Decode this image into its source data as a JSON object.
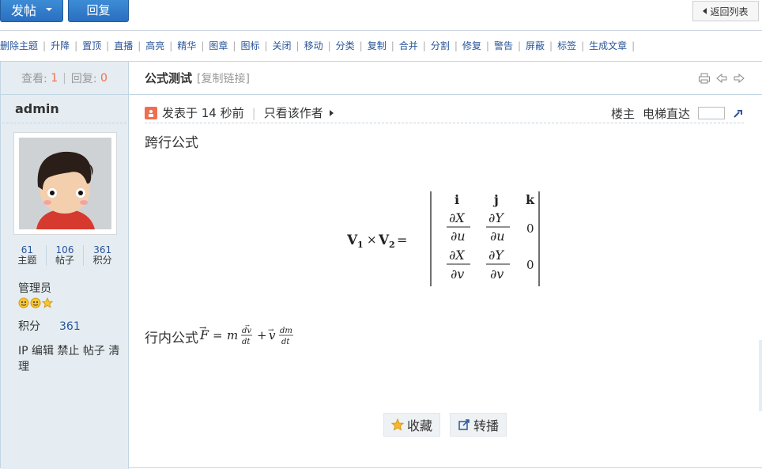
{
  "toolbar": {
    "post_label": "发帖",
    "reply_label": "回复",
    "back_label": "返回列表"
  },
  "mod_actions": [
    "删除主题",
    "升降",
    "置顶",
    "直播",
    "高亮",
    "精华",
    "图章",
    "图标",
    "关闭",
    "移动",
    "分类",
    "复制",
    "合并",
    "分割",
    "修复",
    "警告",
    "屏蔽",
    "标签",
    "生成文章"
  ],
  "stats": {
    "views_label": "查看:",
    "views": "1",
    "replies_label": "回复:",
    "replies": "0"
  },
  "author": {
    "name": "admin",
    "counts": [
      {
        "value": "61",
        "label": "主题"
      },
      {
        "value": "106",
        "label": "帖子"
      },
      {
        "value": "361",
        "label": "积分"
      }
    ],
    "role": "管理员",
    "points_label": "积分",
    "points": "361",
    "admin_links": "IP 编辑 禁止 帖子 清理"
  },
  "thread": {
    "title": "公式测试",
    "copy_link": "[复制链接]"
  },
  "post": {
    "posted": "发表于 14 秒前",
    "only_author": "只看该作者",
    "floor": "楼主",
    "elevator": "电梯直达",
    "heading": "跨行公式",
    "inline_label": "行内公式"
  },
  "actions": {
    "favorite": "收藏",
    "share": "转播"
  },
  "icons": [
    "print-icon",
    "prev-thread-icon",
    "next-thread-icon",
    "post-author-icon",
    "go-floor-icon",
    "star-icon",
    "share-icon"
  ]
}
